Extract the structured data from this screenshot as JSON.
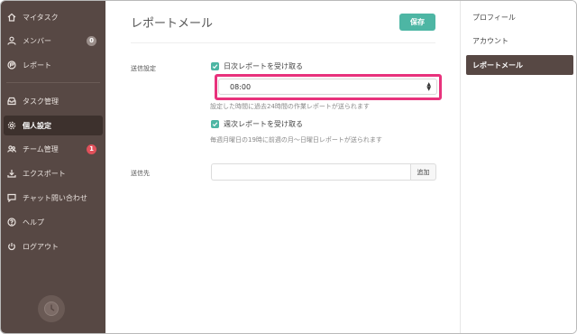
{
  "sidebar": {
    "items": [
      {
        "label": "マイタスク",
        "icon": "home-icon"
      },
      {
        "label": "メンバー",
        "icon": "user-icon",
        "badge": "0"
      },
      {
        "label": "レポート",
        "icon": "report-icon"
      },
      {
        "label": "タスク管理",
        "icon": "inbox-icon"
      },
      {
        "label": "個人設定",
        "icon": "gear-icon"
      },
      {
        "label": "チーム管理",
        "icon": "team-icon",
        "badge": "1"
      },
      {
        "label": "エクスポート",
        "icon": "download-icon"
      },
      {
        "label": "チャット問い合わせ",
        "icon": "chat-icon"
      },
      {
        "label": "ヘルプ",
        "icon": "help-icon"
      },
      {
        "label": "ログアウト",
        "icon": "power-icon"
      }
    ]
  },
  "main": {
    "title": "レポートメール",
    "save_label": "保存",
    "send_settings_label": "送信設定",
    "daily_checkbox_label": "日次レポートを受け取る",
    "daily_time_value": "08:00",
    "daily_hint": "設定した時間に過去24時間の作業レポートが送られます",
    "weekly_checkbox_label": "週次レポートを受け取る",
    "weekly_hint": "毎週月曜日の19時に前週の月〜日曜日レポートが送られます",
    "recipient_label": "送信先",
    "recipient_value": "",
    "add_label": "追加"
  },
  "right_panel": {
    "items": [
      {
        "label": "プロフィール",
        "active": false
      },
      {
        "label": "アカウント",
        "active": false
      },
      {
        "label": "レポートメール",
        "active": true
      }
    ]
  },
  "colors": {
    "sidebar_bg": "#574844",
    "accent": "#4db6a4",
    "highlight": "#e8327c",
    "badge_red": "#e0505a"
  }
}
